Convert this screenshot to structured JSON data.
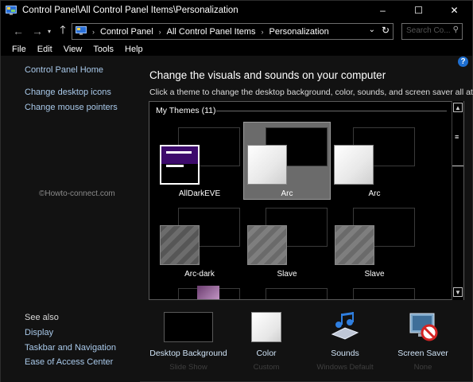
{
  "window": {
    "title": "Control Panel\\All Control Panel Items\\Personalization"
  },
  "controls": {
    "minimize": "–",
    "maximize": "☐",
    "close": "✕"
  },
  "address": {
    "crumbs": [
      "Control Panel",
      "All Control Panel Items",
      "Personalization"
    ],
    "search_placeholder": "Search Co..."
  },
  "menu": [
    "File",
    "Edit",
    "View",
    "Tools",
    "Help"
  ],
  "sidebar": {
    "home": "Control Panel Home",
    "links": [
      "Change desktop icons",
      "Change mouse pointers"
    ],
    "see_also_title": "See also",
    "see_also": [
      "Display",
      "Taskbar and Navigation",
      "Ease of Access Center"
    ]
  },
  "watermark": "©Howto-connect.com",
  "main": {
    "heading": "Change the visuals and sounds on your computer",
    "subheading": "Click a theme to change the desktop background, color, sounds, and screen saver all at once.",
    "group": "My Themes (11)",
    "themes": [
      "AllDarkEVE",
      "Arc",
      "Arc",
      "Arc-dark",
      "Slave",
      "Slave"
    ],
    "selected_theme_index": 1
  },
  "customize": [
    {
      "title": "Desktop Background",
      "sub": "Slide Show"
    },
    {
      "title": "Color",
      "sub": "Custom"
    },
    {
      "title": "Sounds",
      "sub": "Windows Default"
    },
    {
      "title": "Screen Saver",
      "sub": "None"
    }
  ],
  "colors": {
    "accent": "#1e6fd1",
    "link": "#a9c9ea",
    "selected_tile": "#6b6b6b"
  }
}
